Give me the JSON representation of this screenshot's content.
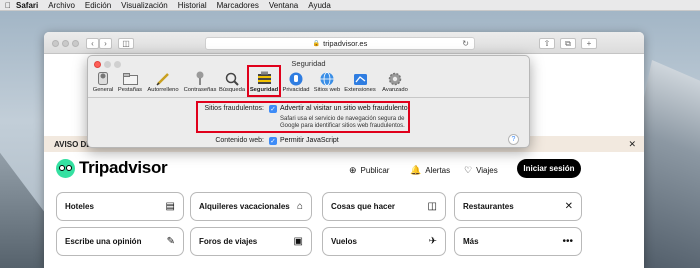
{
  "menubar": {
    "items": [
      "Safari",
      "Archivo",
      "Edición",
      "Visualización",
      "Historial",
      "Marcadores",
      "Ventana",
      "Ayuda"
    ]
  },
  "browser": {
    "url": "tripadvisor.es"
  },
  "page": {
    "cookie_banner": "AVISO DE",
    "logo_text": "Tripadvisor",
    "nav": {
      "publish": "Publicar",
      "alerts": "Alertas",
      "trips": "Viajes",
      "login": "Iniciar sesión"
    },
    "cards": [
      "Hoteles",
      "Alquileres vacacionales",
      "Cosas que hacer",
      "Restaurantes",
      "Escribe una opinión",
      "Foros de viajes",
      "Vuelos",
      "Más"
    ]
  },
  "prefs": {
    "title": "Seguridad",
    "tabs": [
      "General",
      "Pestañas",
      "Autorrelleno",
      "Contraseñas",
      "Búsqueda",
      "Seguridad",
      "Privacidad",
      "Sitios web",
      "Extensiones",
      "Avanzado"
    ],
    "selected_tab": "Seguridad",
    "fraud_label": "Sitios fraudulentos:",
    "fraud_checkbox": "Advertir al visitar un sitio web fraudulento",
    "fraud_note_line1": "Safari usa el servicio de navegación segura de",
    "fraud_note_line2": "Google para identificar sitios web fraudulentos.",
    "web_content_label": "Contenido web:",
    "js_checkbox": "Permitir JavaScript",
    "help": "?"
  },
  "colors": {
    "highlight": "#e0001b",
    "checkbox": "#3d8bf7",
    "tripadvisor_green": "#34e0a1"
  }
}
